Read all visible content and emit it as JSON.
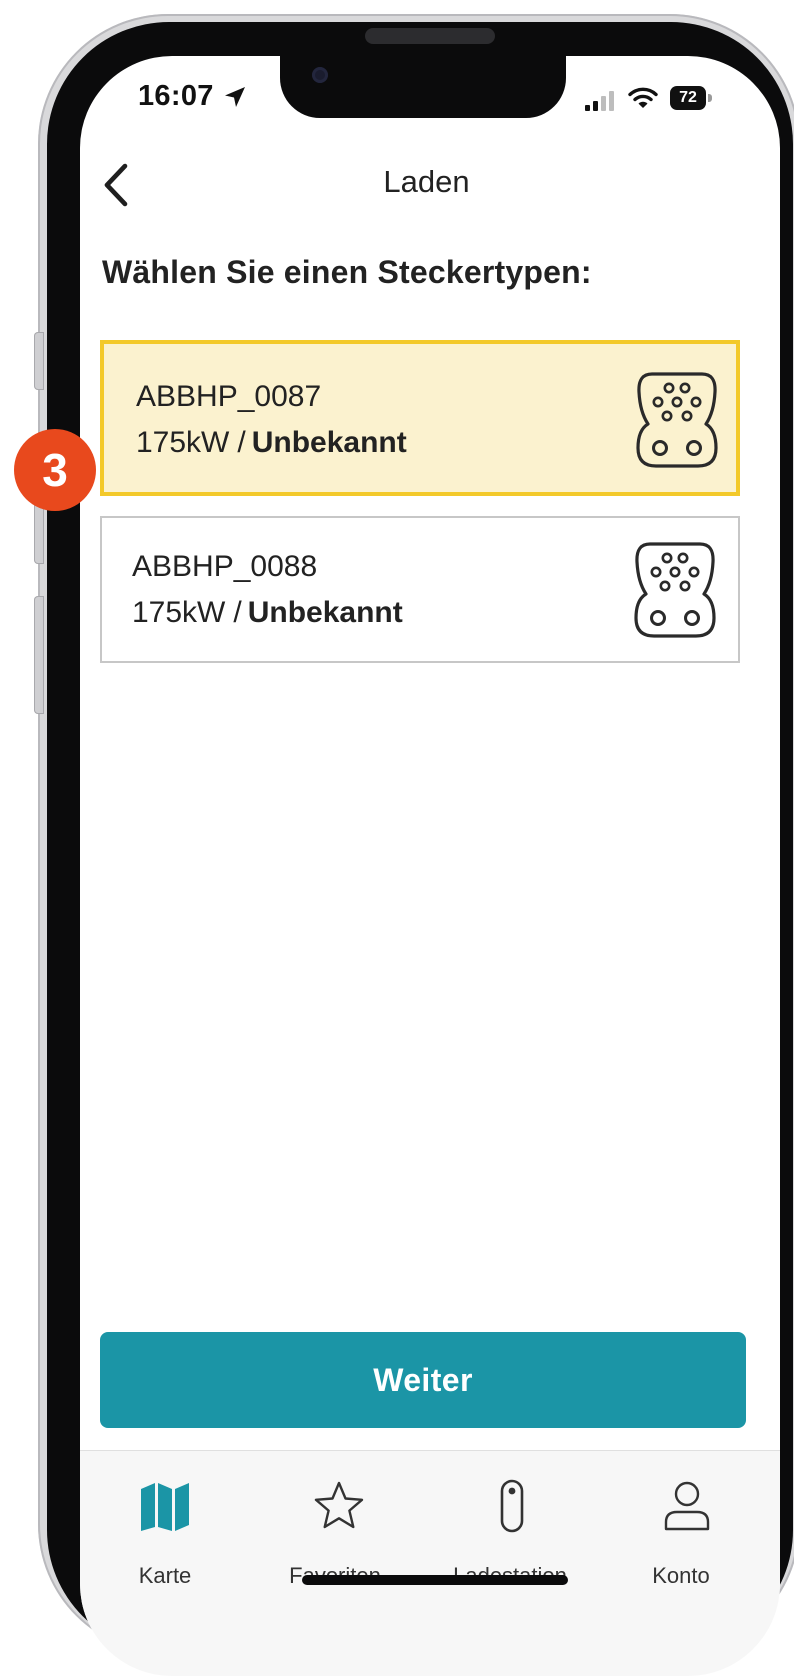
{
  "status_bar": {
    "time": "16:07",
    "battery": "72",
    "icons": [
      "location-arrow-icon",
      "cellular-signal-icon",
      "wifi-icon",
      "battery-icon"
    ]
  },
  "header": {
    "title": "Laden",
    "back_icon": "chevron-left-icon"
  },
  "section_title": "Wählen Sie einen Steckertypen:",
  "connectors": [
    {
      "name": "ABBHP_0087",
      "power": "175kW",
      "separator": "/",
      "status": "Unbekannt",
      "icon": "ccs-plug-icon",
      "selected": true
    },
    {
      "name": "ABBHP_0088",
      "power": "175kW",
      "separator": "/",
      "status": "Unbekannt",
      "icon": "ccs-plug-icon",
      "selected": false
    }
  ],
  "step_marker": "3",
  "continue_button": "Weiter",
  "tab_bar": {
    "items": [
      {
        "label": "Karte",
        "icon": "map-icon",
        "active": true
      },
      {
        "label": "Favoriten",
        "icon": "star-icon",
        "active": false
      },
      {
        "label": "Ladestation",
        "icon": "charging-station-icon",
        "active": false
      },
      {
        "label": "Konto",
        "icon": "user-icon",
        "active": false
      }
    ]
  },
  "colors": {
    "accent": "#1b95a6",
    "selected_background": "#fbf2cf",
    "selected_border": "#f3c92a",
    "step_marker": "#e8491d",
    "text": "#222222"
  }
}
